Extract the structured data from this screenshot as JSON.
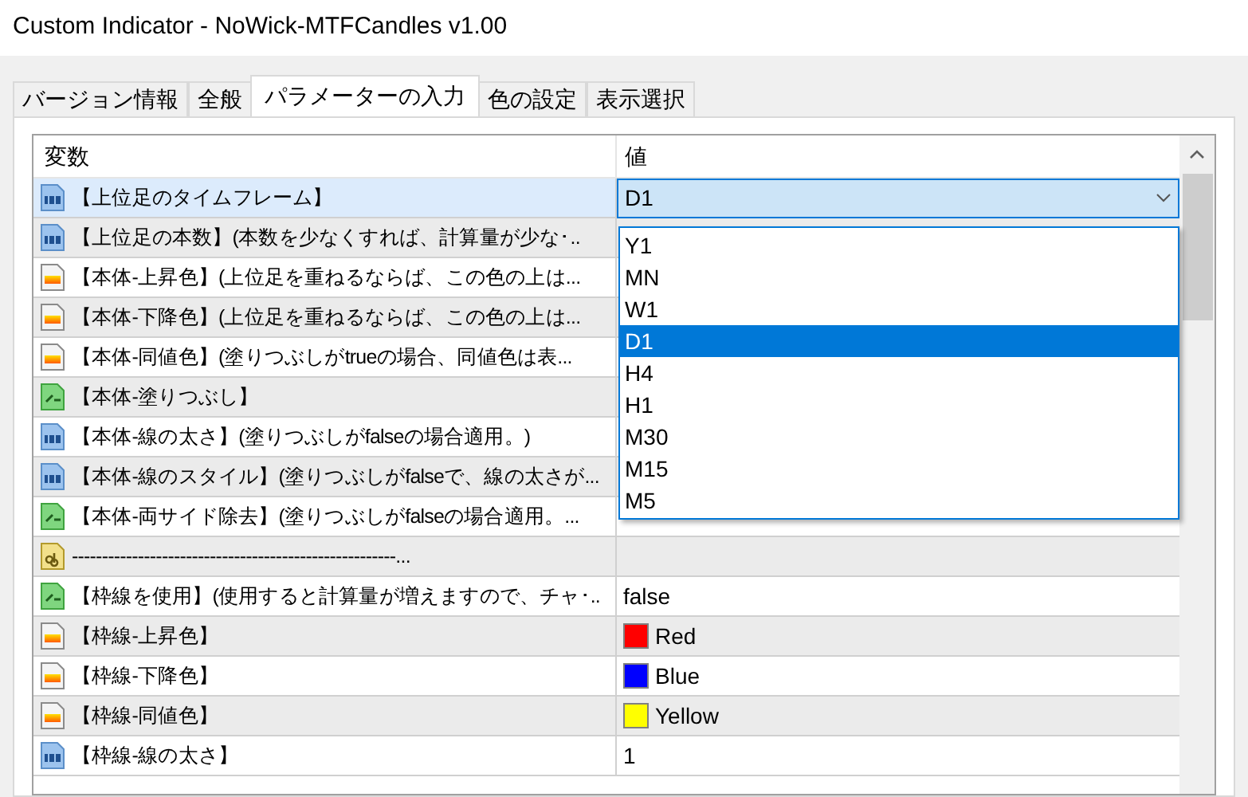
{
  "window": {
    "title": "Custom Indicator - NoWick-MTFCandles v1.00"
  },
  "tabs": [
    {
      "label": "バージョン情報",
      "selected": false
    },
    {
      "label": "全般",
      "selected": false
    },
    {
      "label": "パラメーターの入力",
      "selected": true
    },
    {
      "label": "色の設定",
      "selected": false
    },
    {
      "label": "表示選択",
      "selected": false
    }
  ],
  "table": {
    "columns": [
      "変数",
      "値"
    ],
    "rows": [
      {
        "kind": "int",
        "name": "【上位足のタイムフレーム】",
        "selected": true,
        "dropdown": {
          "value": "D1",
          "expanded": true,
          "options": [
            {
              "label": "Y1",
              "selected": false
            },
            {
              "label": "MN",
              "selected": false
            },
            {
              "label": "W1",
              "selected": false
            },
            {
              "label": "D1",
              "selected": true
            },
            {
              "label": "H4",
              "selected": false
            },
            {
              "label": "H1",
              "selected": false
            },
            {
              "label": "M30",
              "selected": false
            },
            {
              "label": "M15",
              "selected": false
            },
            {
              "label": "M5",
              "selected": false
            }
          ]
        }
      },
      {
        "kind": "int",
        "name": "【上位足の本数】(本数を少なくすれば、計算量が少な･..",
        "selected": false
      },
      {
        "kind": "color",
        "name": "【本体-上昇色】(上位足を重ねるならば、この色の上は...",
        "selected": false
      },
      {
        "kind": "color",
        "name": "【本体-下降色】(上位足を重ねるならば、この色の上は...",
        "selected": false
      },
      {
        "kind": "color",
        "name": "【本体-同値色】(塗りつぶしがtrueの場合、同値色は表...",
        "selected": false
      },
      {
        "kind": "bool",
        "name": "【本体-塗りつぶし】",
        "selected": false
      },
      {
        "kind": "int",
        "name": "【本体-線の太さ】(塗りつぶしがfalseの場合適用。)",
        "selected": false
      },
      {
        "kind": "int",
        "name": "【本体-線のスタイル】(塗りつぶしがfalseで、線の太さが...",
        "selected": false
      },
      {
        "kind": "bool",
        "name": "【本体-両サイド除去】(塗りつぶしがfalseの場合適用。...",
        "selected": false
      },
      {
        "kind": "string",
        "name": "------------------------------------------------------...",
        "selected": false
      },
      {
        "kind": "bool",
        "name": "【枠線を使用】(使用すると計算量が増えますので、チャ･..",
        "selected": false,
        "value": "false"
      },
      {
        "kind": "color",
        "name": "【枠線-上昇色】",
        "selected": false,
        "value": "Red",
        "color": "#ff0000"
      },
      {
        "kind": "color",
        "name": "【枠線-下降色】",
        "selected": false,
        "value": "Blue",
        "color": "#0000ff"
      },
      {
        "kind": "color",
        "name": "【枠線-同値色】",
        "selected": false,
        "value": "Yellow",
        "color": "#ffff00"
      },
      {
        "kind": "int",
        "name": "【枠線-線の太さ】",
        "selected": false,
        "value": "1"
      }
    ]
  }
}
